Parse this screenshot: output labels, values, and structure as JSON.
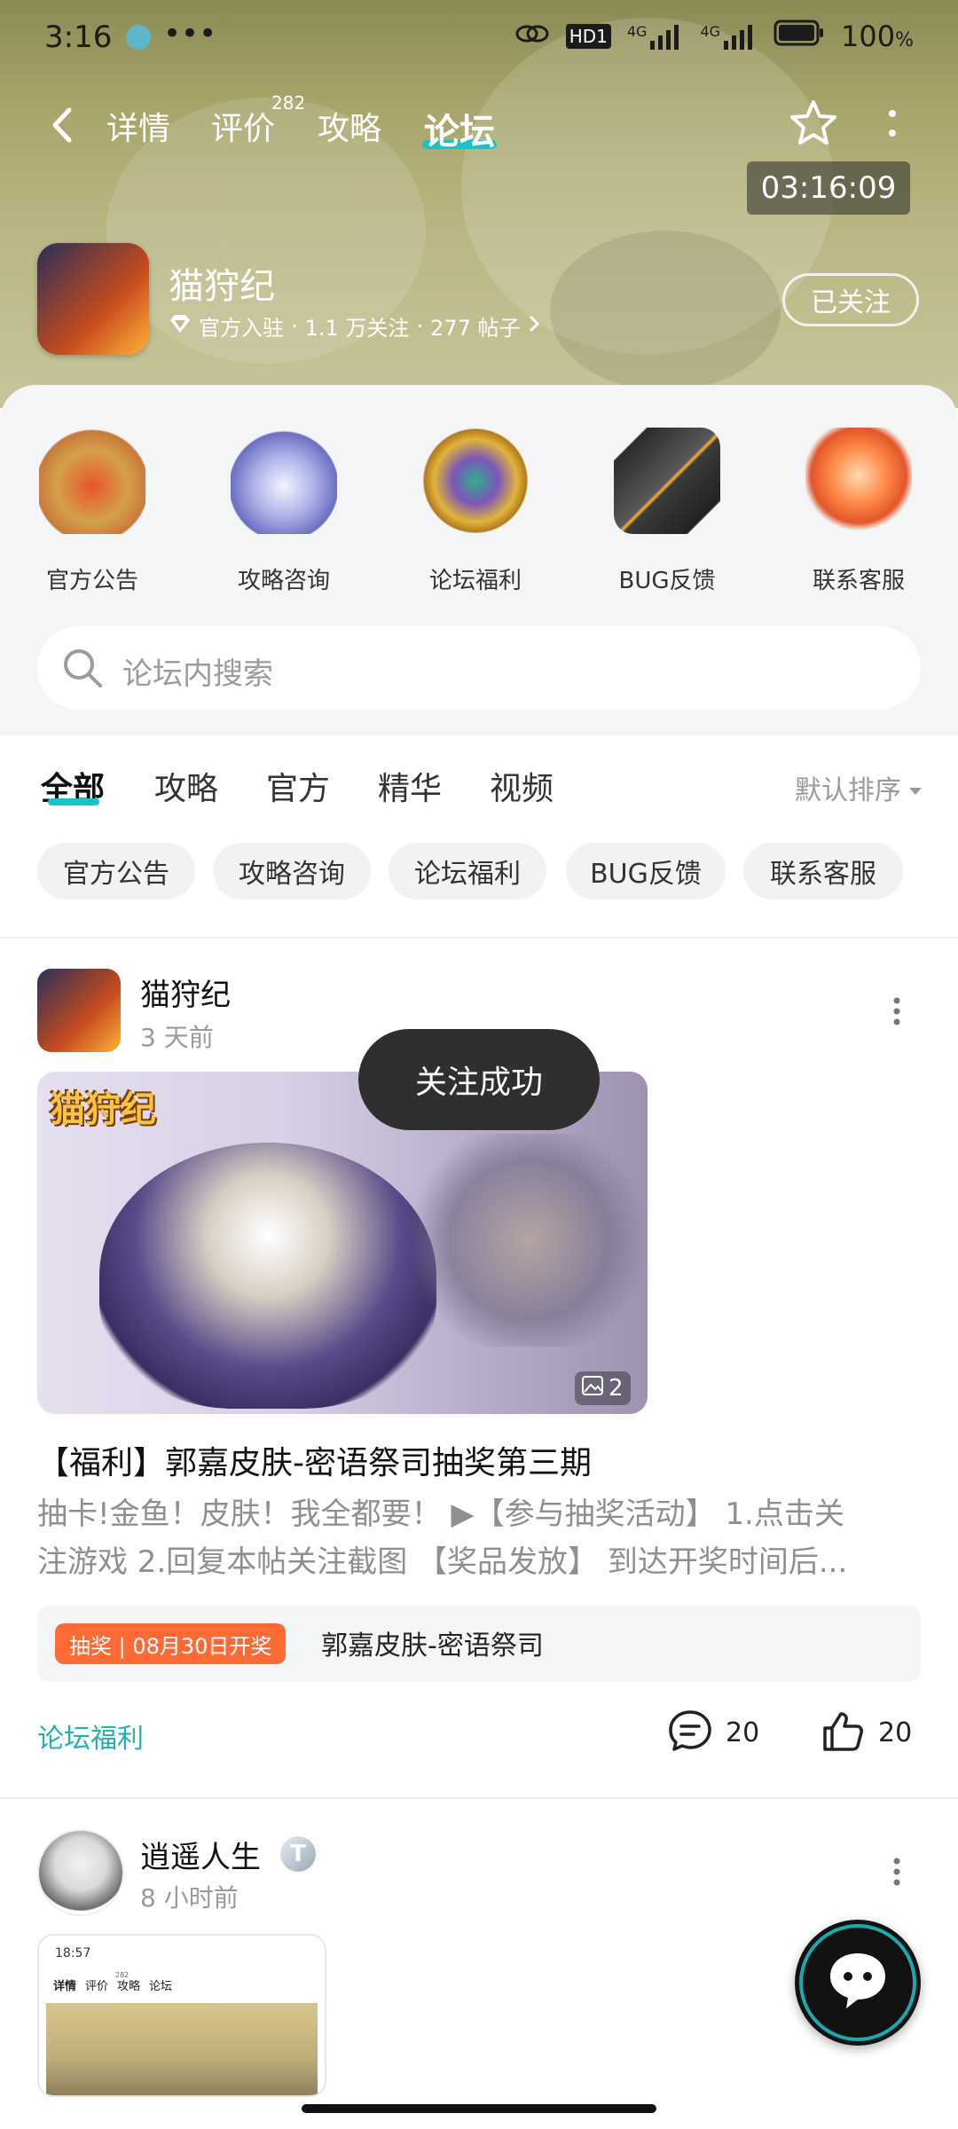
{
  "status": {
    "time": "3:16",
    "dots": "•••",
    "hd": "HD1",
    "net1": "4G",
    "net2": "4G",
    "battery": "100",
    "battery_unit": "%"
  },
  "nav": {
    "tabs": [
      {
        "label": "详情",
        "badge": ""
      },
      {
        "label": "评价",
        "badge": "282"
      },
      {
        "label": "攻略",
        "badge": ""
      },
      {
        "label": "论坛",
        "badge": ""
      }
    ],
    "active_tab": "论坛",
    "timer": "03:16:09"
  },
  "app": {
    "name": "猫狩纪",
    "official": "官方入驻",
    "followers": "1.1 万关注",
    "posts": "277 帖子",
    "dot": "·",
    "follow_state": "已关注"
  },
  "categories": [
    {
      "label": "官方公告",
      "icon": "seal-icon"
    },
    {
      "label": "攻略咨询",
      "icon": "paw-icon"
    },
    {
      "label": "论坛福利",
      "icon": "medal-icon"
    },
    {
      "label": "BUG反馈",
      "icon": "crystal-icon"
    },
    {
      "label": "联系客服",
      "icon": "koi-icon"
    }
  ],
  "search": {
    "placeholder": "论坛内搜索"
  },
  "filter_tabs": [
    "全部",
    "攻略",
    "官方",
    "精华",
    "视频"
  ],
  "sort": "默认排序",
  "chips": [
    "官方公告",
    "攻略咨询",
    "论坛福利",
    "BUG反馈",
    "联系客服"
  ],
  "post1": {
    "author": "猫狩纪",
    "time": "3 天前",
    "image_count": "2",
    "banner_text": "猫狩纪",
    "title": "【福利】郭嘉皮肤-密语祭司抽奖第三期",
    "excerpt_line1": "抽卡!金鱼！皮肤！我全都要！ ▶【参与抽奖活动】 1.点击关",
    "excerpt_line2": "注游戏 2.回复本帖关注截图 【奖品发放】 到达开奖时间后...",
    "lottery_tag": "抽奖 | 08月30日开奖",
    "lottery_prize": "郭嘉皮肤-密语祭司",
    "forum": "论坛福利",
    "comments": "20",
    "likes": "20"
  },
  "toast": "关注成功",
  "post2": {
    "author": "逍遥人生",
    "time": "8 小时前",
    "level": "T",
    "thumb_time": "18:57",
    "thumb_tabs": [
      "详情",
      "评价",
      "攻略",
      "论坛"
    ],
    "thumb_badge": "282"
  },
  "colors": {
    "accent": "#17c3c7",
    "lottery": "#ff6a35",
    "forum_tag": "#1fb3b8"
  }
}
